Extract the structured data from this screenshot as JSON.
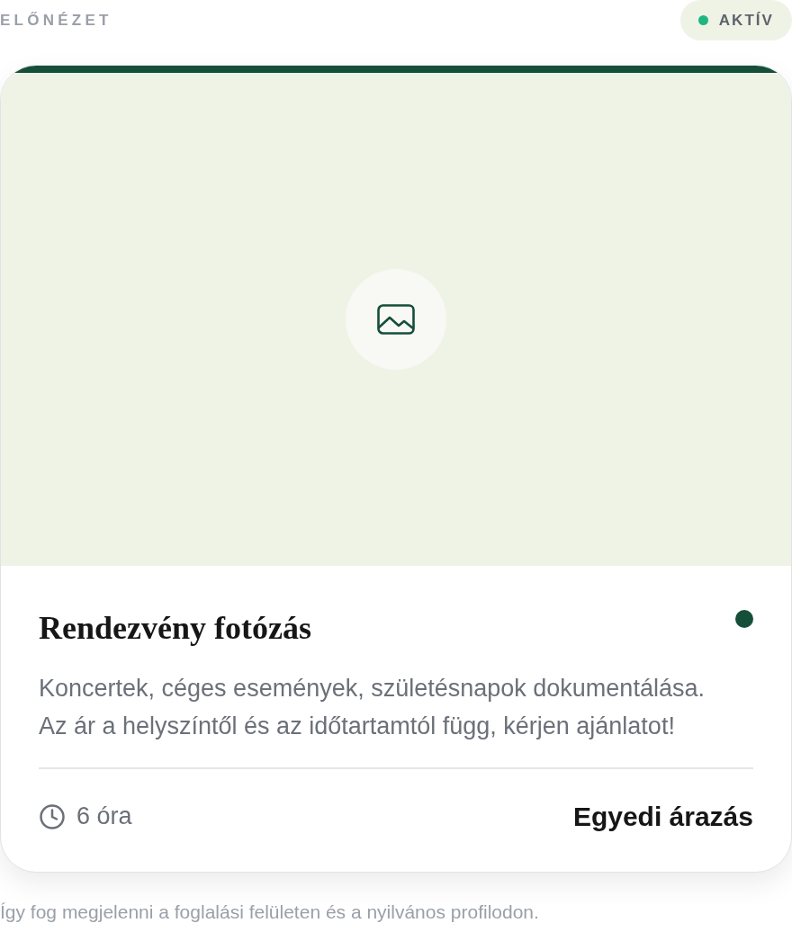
{
  "header": {
    "title": "ELŐNÉZET",
    "status": {
      "label": "AKTÍV",
      "active": true
    }
  },
  "card": {
    "image": {
      "kind": "placeholder"
    },
    "title": "Rendezvény fotózás",
    "active": true,
    "description": "Koncertek, céges események, születésnapok dokumentálása. Az ár a helyszíntől és az időtartamtól függ, kérjen ajánlatot!",
    "duration": "6 óra",
    "price": "Egyedi árazás"
  },
  "caption": "Így fog megjelenni a foglalási felületen és a nyilvános profilodon."
}
